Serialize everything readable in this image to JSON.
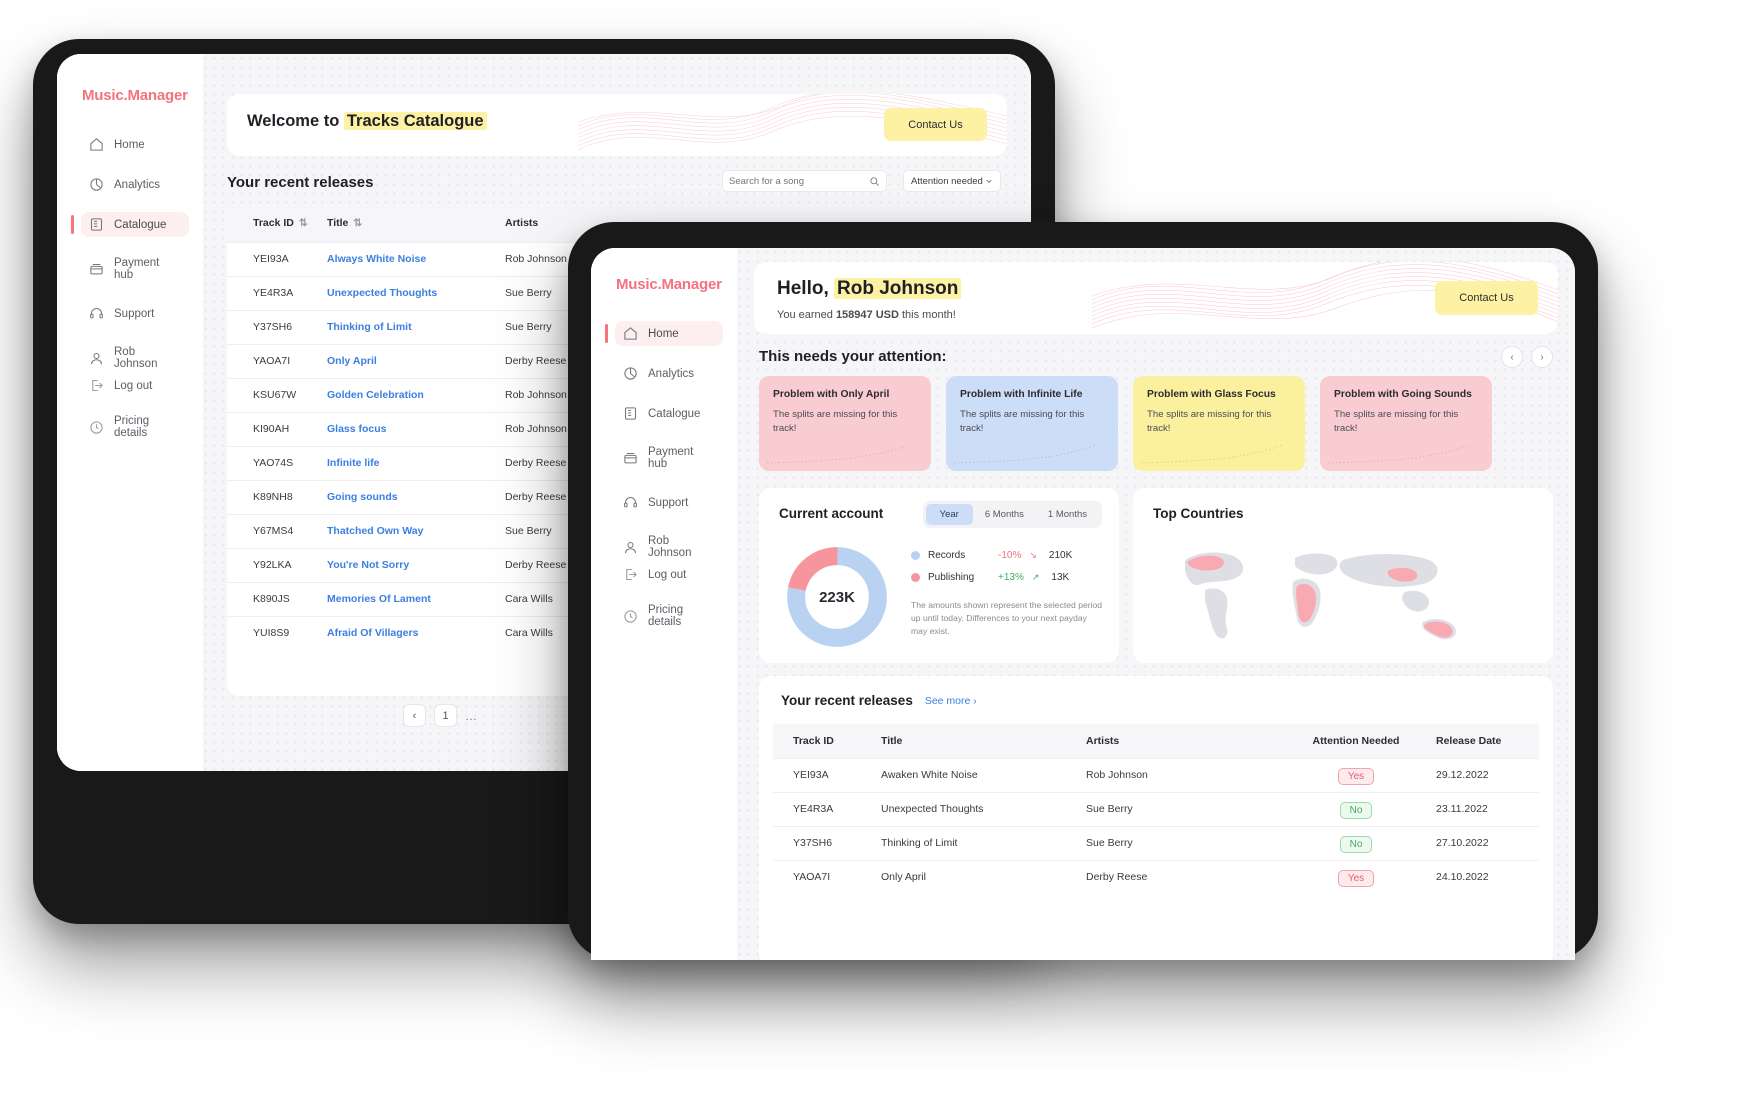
{
  "brand": "Music.Manager",
  "back_tablet": {
    "sidebar": {
      "brand": "Music.Manager",
      "items": [
        {
          "label": "Home",
          "icon": "home-icon"
        },
        {
          "label": "Analytics",
          "icon": "analytics-icon"
        },
        {
          "label": "Catalogue",
          "icon": "catalogue-icon"
        },
        {
          "label": "Payment hub",
          "icon": "payment-icon"
        },
        {
          "label": "Support",
          "icon": "support-icon"
        },
        {
          "label": "Rob Johnson",
          "icon": "user-icon"
        }
      ],
      "active": "Catalogue",
      "bottom": [
        {
          "label": "Log out",
          "icon": "logout-icon"
        },
        {
          "label": "Pricing details",
          "icon": "pricing-icon"
        }
      ]
    },
    "header": {
      "welcome_prefix": "Welcome to",
      "welcome_highlight": "Tracks Catalogue",
      "contact_label": "Contact Us"
    },
    "section_title": "Your recent releases",
    "search": {
      "placeholder": "Search for a song",
      "value": "",
      "icon": "search-icon"
    },
    "filter": {
      "value": "Attention needed",
      "icon": "chevron-down-icon"
    },
    "table": {
      "columns": [
        "Track ID",
        "Title",
        "Artists"
      ],
      "rows": [
        {
          "id": "YEI93A",
          "title": "Always White Noise",
          "artist": "Rob Johnson"
        },
        {
          "id": "YE4R3A",
          "title": "Unexpected Thoughts",
          "artist": "Sue Berry"
        },
        {
          "id": "Y37SH6",
          "title": "Thinking of Limit",
          "artist": "Sue Berry"
        },
        {
          "id": "YAOA7I",
          "title": "Only April",
          "artist": "Derby Reese"
        },
        {
          "id": "KSU67W",
          "title": "Golden Celebration",
          "artist": "Rob Johnson"
        },
        {
          "id": "KI90AH",
          "title": "Glass focus",
          "artist": "Rob Johnson"
        },
        {
          "id": "YAO74S",
          "title": "Infinite life",
          "artist": "Derby Reese"
        },
        {
          "id": "K89NH8",
          "title": "Going sounds",
          "artist": "Derby Reese"
        },
        {
          "id": "Y67MS4",
          "title": "Thatched Own Way",
          "artist": "Sue Berry"
        },
        {
          "id": "Y92LKA",
          "title": "You're Not Sorry",
          "artist": "Derby Reese"
        },
        {
          "id": "K890JS",
          "title": "Memories Of Lament",
          "artist": "Cara Wills"
        },
        {
          "id": "YUI8S9",
          "title": "Afraid Of Villagers",
          "artist": "Cara Wills"
        }
      ]
    },
    "pagination": {
      "prev": "‹",
      "page": "1",
      "more": "…"
    }
  },
  "front_tablet": {
    "sidebar": {
      "brand": "Music.Manager",
      "items": [
        {
          "label": "Home",
          "icon": "home-icon"
        },
        {
          "label": "Analytics",
          "icon": "analytics-icon"
        },
        {
          "label": "Catalogue",
          "icon": "catalogue-icon"
        },
        {
          "label": "Payment hub",
          "icon": "payment-icon"
        },
        {
          "label": "Support",
          "icon": "support-icon"
        },
        {
          "label": "Rob Johnson",
          "icon": "user-icon"
        }
      ],
      "active": "Home",
      "bottom": [
        {
          "label": "Log out",
          "icon": "logout-icon"
        },
        {
          "label": "Pricing details",
          "icon": "pricing-icon"
        }
      ]
    },
    "header": {
      "greeting_prefix": "Hello,",
      "user_name": "Rob Johnson",
      "earned_prefix": "You earned",
      "earned_amount": "158947 USD",
      "earned_suffix": "this month!",
      "contact_label": "Contact Us"
    },
    "attention": {
      "title": "This needs your attention:",
      "prev": "‹",
      "next": "›",
      "cards": [
        {
          "title": "Problem with Only April",
          "text": "The splits are missing for this track!",
          "color": "#f9ccd1"
        },
        {
          "title": "Problem with Infinite Life",
          "text": "The splits are missing for this track!",
          "color": "#ccddf7"
        },
        {
          "title": "Problem with Glass Focus",
          "text": "The splits are missing for this track!",
          "color": "#fbf09e"
        },
        {
          "title": "Problem with Going Sounds",
          "text": "The splits are missing for this track!",
          "color": "#f9ccd1"
        }
      ]
    },
    "account": {
      "title": "Current account",
      "ranges": [
        "Year",
        "6 Months",
        "1 Months"
      ],
      "active_range": "Year",
      "center_value": "223K",
      "legend": [
        {
          "name": "Records",
          "delta": "-10%",
          "value": "210K",
          "color": "#b9d2f2",
          "delta_color": "#f1707e",
          "trend": "down"
        },
        {
          "name": "Publishing",
          "delta": "+13%",
          "value": "13K",
          "color": "#f7959f",
          "delta_color": "#3fab63",
          "trend": "up"
        }
      ],
      "disclaimer": "The amounts shown represent the selected period up until today. Differences to your next payday may exist."
    },
    "countries": {
      "title": "Top Countries"
    },
    "releases": {
      "title": "Your recent releases",
      "see_more": "See more",
      "see_more_icon": "chevron-right-icon",
      "columns": [
        "Track ID",
        "Title",
        "Artists",
        "Attention Needed",
        "Release Date"
      ],
      "rows": [
        {
          "id": "YEI93A",
          "title": "Awaken White Noise",
          "artist": "Rob Johnson",
          "attention": "Yes",
          "date": "29.12.2022"
        },
        {
          "id": "YE4R3A",
          "title": "Unexpected Thoughts",
          "artist": "Sue Berry",
          "attention": "No",
          "date": "23.11.2022"
        },
        {
          "id": "Y37SH6",
          "title": "Thinking of Limit",
          "artist": "Sue Berry",
          "attention": "No",
          "date": "27.10.2022"
        },
        {
          "id": "YAOA7I",
          "title": "Only April",
          "artist": "Derby Reese",
          "attention": "Yes",
          "date": "24.10.2022"
        }
      ]
    }
  },
  "chart_data": {
    "type": "pie",
    "title": "Current account",
    "labels": [
      "Records",
      "Publishing"
    ],
    "values": [
      210,
      13
    ],
    "value_labels": [
      "210K",
      "13K"
    ],
    "center_label": "223K",
    "colors": [
      "#b9d2f2",
      "#f7959f"
    ],
    "legend_position": "right",
    "deltas": [
      "-10%",
      "+13%"
    ]
  }
}
